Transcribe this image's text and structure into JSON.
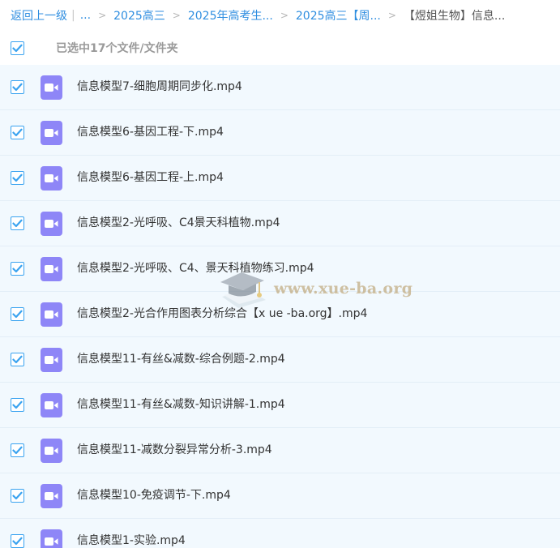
{
  "breadcrumb": {
    "back_label": "返回上一级",
    "ellipsis": "...",
    "items": [
      "2025高三",
      "2025年高考生...",
      "2025高三【周...",
      "【煜姐生物】信息..."
    ]
  },
  "selection": {
    "summary": "已选中17个文件/文件夹"
  },
  "files": [
    {
      "name": "信息模型7-细胞周期同步化.mp4"
    },
    {
      "name": "信息模型6-基因工程-下.mp4"
    },
    {
      "name": "信息模型6-基因工程-上.mp4"
    },
    {
      "name": "信息模型2-光呼吸、C4景天科植物.mp4"
    },
    {
      "name": "信息模型2-光呼吸、C4、景天科植物练习.mp4"
    },
    {
      "name": "信息模型2-光合作用图表分析综合【x ue -ba.org】.mp4"
    },
    {
      "name": "信息模型11-有丝&减数-综合例题-2.mp4"
    },
    {
      "name": "信息模型11-有丝&减数-知识讲解-1.mp4"
    },
    {
      "name": "信息模型11-减数分裂异常分析-3.mp4"
    },
    {
      "name": "信息模型10-免疫调节-下.mp4"
    },
    {
      "name": "信息模型1-实验.mp4"
    }
  ],
  "watermark": {
    "text": "www.xue-ba.org"
  },
  "colors": {
    "link": "#2f8ee0",
    "checkbox_accent": "#3aa3f0",
    "video_icon": "#8e86f7",
    "row_background": "#f2f9fe"
  },
  "icons": {
    "checkbox": "check-icon",
    "file": "video-file-icon",
    "watermark": "graduation-cap-icon"
  }
}
